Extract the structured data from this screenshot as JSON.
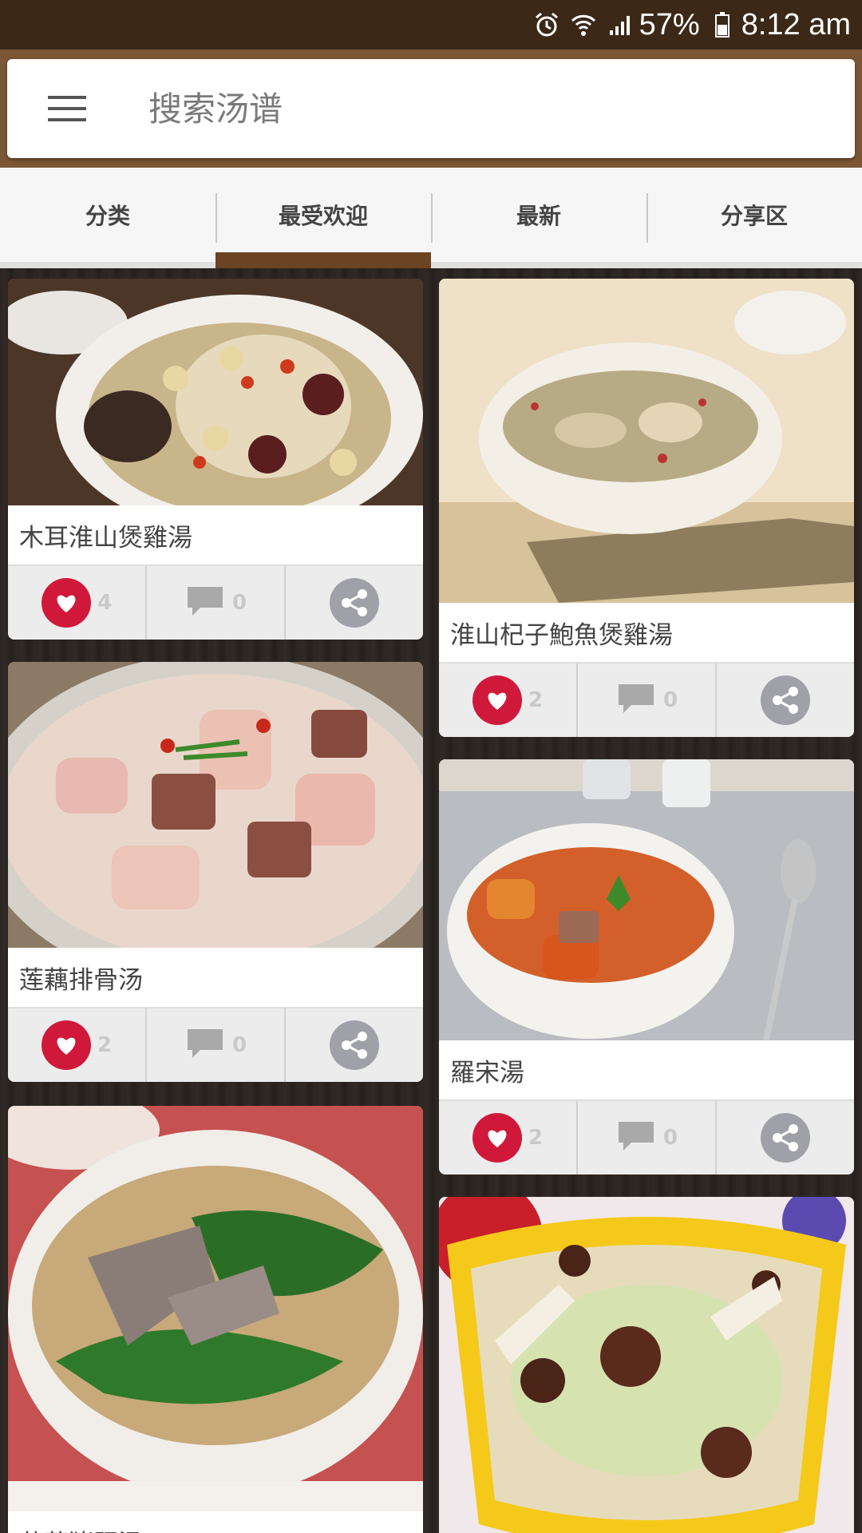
{
  "status_bar": {
    "battery": "57%",
    "time": "8:12 am"
  },
  "search": {
    "placeholder": "搜索汤谱"
  },
  "tabs": [
    {
      "label": "分类"
    },
    {
      "label": "最受欢迎",
      "active": true
    },
    {
      "label": "最新"
    },
    {
      "label": "分享区"
    }
  ],
  "recipes": [
    {
      "title": "木耳淮山煲雞湯",
      "likes": "4",
      "comments": "0"
    },
    {
      "title": "淮山杞子鮑魚煲雞湯",
      "likes": "2",
      "comments": "0"
    },
    {
      "title": "莲藕排骨汤",
      "likes": "2",
      "comments": "0"
    },
    {
      "title": "羅宋湯",
      "likes": "2",
      "comments": "0"
    },
    {
      "title": "菠菜猪肝汤"
    }
  ],
  "colors": {
    "status_bar": "#3b2816",
    "header": "#7a5634",
    "tab_indicator": "#6b4423",
    "like": "#d0183a",
    "share": "#a0a0a8"
  }
}
